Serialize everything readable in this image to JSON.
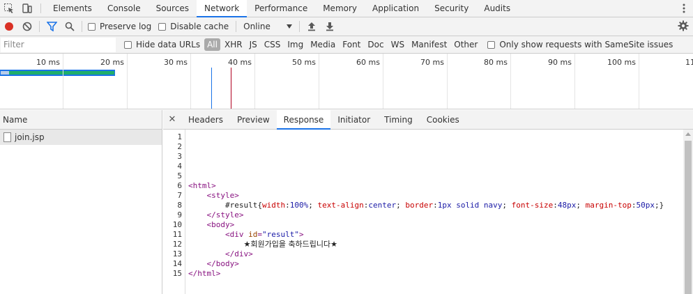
{
  "panel_tabs": [
    "Elements",
    "Console",
    "Sources",
    "Network",
    "Performance",
    "Memory",
    "Application",
    "Security",
    "Audits"
  ],
  "active_panel": "Network",
  "toolbar": {
    "preserve_log_label": "Preserve log",
    "disable_cache_label": "Disable cache",
    "throttle_value": "Online"
  },
  "filter": {
    "placeholder": "Filter",
    "hide_data_urls_label": "Hide data URLs",
    "types": [
      "All",
      "XHR",
      "JS",
      "CSS",
      "Img",
      "Media",
      "Font",
      "Doc",
      "WS",
      "Manifest",
      "Other"
    ],
    "active_type": "All",
    "samesite_label": "Only show requests with SameSite issues"
  },
  "timeline": {
    "ticks": [
      "10 ms",
      "20 ms",
      "30 ms",
      "40 ms",
      "50 ms",
      "60 ms",
      "70 ms",
      "80 ms",
      "90 ms",
      "100 ms",
      "110"
    ],
    "colors": {
      "bar_border": "#1a73e8",
      "bar_fill": "#1fae6a",
      "dom_content_loaded": "#1a73e8",
      "load": "#b00020"
    }
  },
  "requests": {
    "header": "Name",
    "items": [
      {
        "name": "join.jsp"
      }
    ]
  },
  "detail": {
    "tabs": [
      "Headers",
      "Preview",
      "Response",
      "Initiator",
      "Timing",
      "Cookies"
    ],
    "active_tab": "Response"
  },
  "response": {
    "line_numbers": [
      "1",
      "2",
      "3",
      "4",
      "5",
      "6",
      "7",
      "8",
      "9",
      "10",
      "11",
      "12",
      "13",
      "14",
      "15"
    ],
    "css_selector": "#result",
    "css_rule": [
      {
        "prop": "width",
        "value": "100%"
      },
      {
        "prop": "text-align",
        "value": "center"
      },
      {
        "prop": "border",
        "value": "1px solid navy"
      },
      {
        "prop": "font-size",
        "value": "48px"
      },
      {
        "prop": "margin-top",
        "value": "50px"
      }
    ],
    "div_id": "\"result\"",
    "message": "★회원가입을 축하드립니다★"
  }
}
